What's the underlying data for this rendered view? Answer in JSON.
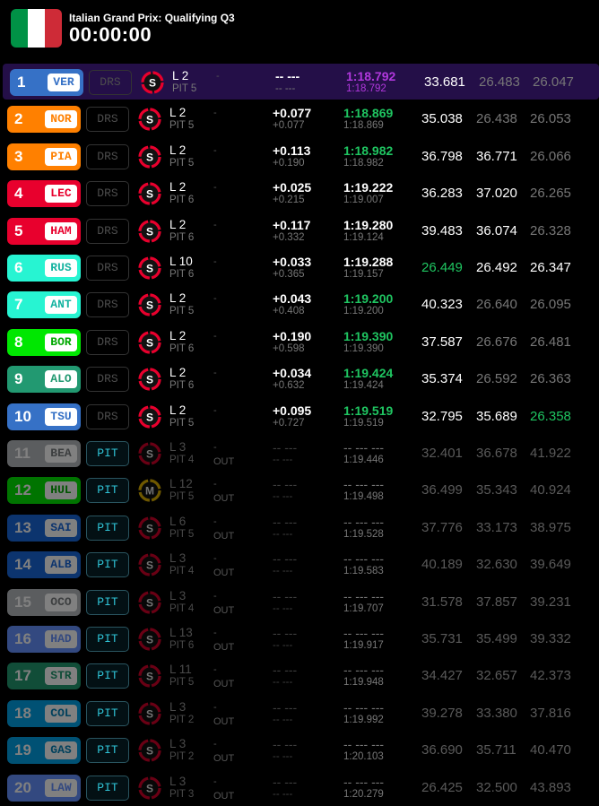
{
  "header": {
    "title": "Italian Grand Prix: Qualifying Q3",
    "timer": "00:00:00",
    "flag_colors": [
      "#009246",
      "#ffffff",
      "#ce2b37"
    ]
  },
  "colors": {
    "purple": "#b138dd",
    "green": "#1fc561",
    "white": "#ffffff",
    "grey": "#777777"
  },
  "drivers": [
    {
      "pos": "1",
      "code": "VER",
      "team_color": "#3671c6",
      "code_color": "#3671c6",
      "status": "DRS",
      "tyre": "S",
      "tyre_icon": "soft-tyre",
      "laps": "L 2",
      "pit": "PIT 5",
      "stint": "-",
      "stint2": "",
      "gap": "-- ---",
      "gap2": "-- ---",
      "best": "1:18.792",
      "best_color": "purple",
      "last": "1:18.792",
      "last_color": "purple",
      "s1": "33.681",
      "s1_color": "white",
      "s2": "26.483",
      "s2_color": "grey",
      "s3": "26.047",
      "s3_color": "grey",
      "out": false,
      "leader": true
    },
    {
      "pos": "2",
      "code": "NOR",
      "team_color": "#ff8000",
      "code_color": "#ff8000",
      "status": "DRS",
      "tyre": "S",
      "tyre_icon": "soft-tyre",
      "laps": "L 2",
      "pit": "PIT 5",
      "stint": "-",
      "stint2": "",
      "gap": "+0.077",
      "gap2": "+0.077",
      "best": "1:18.869",
      "best_color": "green",
      "last": "1:18.869",
      "last_color": "grey",
      "s1": "35.038",
      "s1_color": "white",
      "s2": "26.438",
      "s2_color": "grey",
      "s3": "26.053",
      "s3_color": "grey",
      "out": false,
      "leader": false
    },
    {
      "pos": "3",
      "code": "PIA",
      "team_color": "#ff8000",
      "code_color": "#ff8000",
      "status": "DRS",
      "tyre": "S",
      "tyre_icon": "soft-tyre",
      "laps": "L 2",
      "pit": "PIT 5",
      "stint": "-",
      "stint2": "",
      "gap": "+0.113",
      "gap2": "+0.190",
      "best": "1:18.982",
      "best_color": "green",
      "last": "1:18.982",
      "last_color": "grey",
      "s1": "36.798",
      "s1_color": "white",
      "s2": "36.771",
      "s2_color": "white",
      "s3": "26.066",
      "s3_color": "grey",
      "out": false,
      "leader": false
    },
    {
      "pos": "4",
      "code": "LEC",
      "team_color": "#e8002d",
      "code_color": "#e8002d",
      "status": "DRS",
      "tyre": "S",
      "tyre_icon": "soft-tyre",
      "laps": "L 2",
      "pit": "PIT 6",
      "stint": "-",
      "stint2": "",
      "gap": "+0.025",
      "gap2": "+0.215",
      "best": "1:19.222",
      "best_color": "white",
      "last": "1:19.007",
      "last_color": "grey",
      "s1": "36.283",
      "s1_color": "white",
      "s2": "37.020",
      "s2_color": "white",
      "s3": "26.265",
      "s3_color": "grey",
      "out": false,
      "leader": false
    },
    {
      "pos": "5",
      "code": "HAM",
      "team_color": "#e8002d",
      "code_color": "#e8002d",
      "status": "DRS",
      "tyre": "S",
      "tyre_icon": "soft-tyre",
      "laps": "L 2",
      "pit": "PIT 6",
      "stint": "-",
      "stint2": "",
      "gap": "+0.117",
      "gap2": "+0.332",
      "best": "1:19.280",
      "best_color": "white",
      "last": "1:19.124",
      "last_color": "grey",
      "s1": "39.483",
      "s1_color": "white",
      "s2": "36.074",
      "s2_color": "white",
      "s3": "26.328",
      "s3_color": "grey",
      "out": false,
      "leader": false
    },
    {
      "pos": "6",
      "code": "RUS",
      "team_color": "#27f4d2",
      "code_color": "#14b3a0",
      "status": "DRS",
      "tyre": "S",
      "tyre_icon": "soft-tyre",
      "laps": "L 10",
      "pit": "PIT 6",
      "stint": "-",
      "stint2": "",
      "gap": "+0.033",
      "gap2": "+0.365",
      "best": "1:19.288",
      "best_color": "white",
      "last": "1:19.157",
      "last_color": "grey",
      "s1": "26.449",
      "s1_color": "green",
      "s2": "26.492",
      "s2_color": "white",
      "s3": "26.347",
      "s3_color": "white",
      "out": false,
      "leader": false
    },
    {
      "pos": "7",
      "code": "ANT",
      "team_color": "#27f4d2",
      "code_color": "#14b3a0",
      "status": "DRS",
      "tyre": "S",
      "tyre_icon": "soft-tyre",
      "laps": "L 2",
      "pit": "PIT 5",
      "stint": "-",
      "stint2": "",
      "gap": "+0.043",
      "gap2": "+0.408",
      "best": "1:19.200",
      "best_color": "green",
      "last": "1:19.200",
      "last_color": "grey",
      "s1": "40.323",
      "s1_color": "white",
      "s2": "26.640",
      "s2_color": "grey",
      "s3": "26.095",
      "s3_color": "grey",
      "out": false,
      "leader": false
    },
    {
      "pos": "8",
      "code": "BOR",
      "team_color": "#00e701",
      "code_color": "#00a800",
      "status": "DRS",
      "tyre": "S",
      "tyre_icon": "soft-tyre",
      "laps": "L 2",
      "pit": "PIT 6",
      "stint": "-",
      "stint2": "",
      "gap": "+0.190",
      "gap2": "+0.598",
      "best": "1:19.390",
      "best_color": "green",
      "last": "1:19.390",
      "last_color": "grey",
      "s1": "37.587",
      "s1_color": "white",
      "s2": "26.676",
      "s2_color": "grey",
      "s3": "26.481",
      "s3_color": "grey",
      "out": false,
      "leader": false
    },
    {
      "pos": "9",
      "code": "ALO",
      "team_color": "#229971",
      "code_color": "#229971",
      "status": "DRS",
      "tyre": "S",
      "tyre_icon": "soft-tyre",
      "laps": "L 2",
      "pit": "PIT 6",
      "stint": "-",
      "stint2": "",
      "gap": "+0.034",
      "gap2": "+0.632",
      "best": "1:19.424",
      "best_color": "green",
      "last": "1:19.424",
      "last_color": "grey",
      "s1": "35.374",
      "s1_color": "white",
      "s2": "26.592",
      "s2_color": "grey",
      "s3": "26.363",
      "s3_color": "grey",
      "out": false,
      "leader": false
    },
    {
      "pos": "10",
      "code": "TSU",
      "team_color": "#3671c6",
      "code_color": "#3671c6",
      "status": "DRS",
      "tyre": "S",
      "tyre_icon": "soft-tyre",
      "laps": "L 2",
      "pit": "PIT 5",
      "stint": "-",
      "stint2": "",
      "gap": "+0.095",
      "gap2": "+0.727",
      "best": "1:19.519",
      "best_color": "green",
      "last": "1:19.519",
      "last_color": "grey",
      "s1": "32.795",
      "s1_color": "white",
      "s2": "35.689",
      "s2_color": "white",
      "s3": "26.358",
      "s3_color": "green",
      "out": false,
      "leader": false
    },
    {
      "pos": "11",
      "code": "BEA",
      "team_color": "#b6babd",
      "code_color": "#7a7e80",
      "status": "PIT",
      "tyre": "S",
      "tyre_icon": "soft-tyre",
      "laps": "L 3",
      "pit": "PIT 4",
      "stint": "-",
      "stint2": "OUT",
      "gap": "-- ---",
      "gap2": "-- ---",
      "best": "-- --- ---",
      "best_color": "grey",
      "last": "1:19.446",
      "last_color": "grey",
      "s1": "32.401",
      "s1_color": "grey",
      "s2": "36.678",
      "s2_color": "grey",
      "s3": "41.922",
      "s3_color": "grey",
      "out": true,
      "leader": false
    },
    {
      "pos": "12",
      "code": "HUL",
      "team_color": "#00e701",
      "code_color": "#00a800",
      "status": "PIT",
      "tyre": "M",
      "tyre_icon": "medium-tyre",
      "laps": "L 12",
      "pit": "PIT 5",
      "stint": "-",
      "stint2": "OUT",
      "gap": "-- ---",
      "gap2": "-- ---",
      "best": "-- --- ---",
      "best_color": "grey",
      "last": "1:19.498",
      "last_color": "grey",
      "s1": "36.499",
      "s1_color": "grey",
      "s2": "35.343",
      "s2_color": "grey",
      "s3": "40.924",
      "s3_color": "grey",
      "out": true,
      "leader": false
    },
    {
      "pos": "13",
      "code": "SAI",
      "team_color": "#1868db",
      "code_color": "#1868db",
      "status": "PIT",
      "tyre": "S",
      "tyre_icon": "soft-tyre",
      "laps": "L 6",
      "pit": "PIT 5",
      "stint": "-",
      "stint2": "OUT",
      "gap": "-- ---",
      "gap2": "-- ---",
      "best": "-- --- ---",
      "best_color": "grey",
      "last": "1:19.528",
      "last_color": "grey",
      "s1": "37.776",
      "s1_color": "grey",
      "s2": "33.173",
      "s2_color": "grey",
      "s3": "38.975",
      "s3_color": "grey",
      "out": true,
      "leader": false
    },
    {
      "pos": "14",
      "code": "ALB",
      "team_color": "#1868db",
      "code_color": "#1868db",
      "status": "PIT",
      "tyre": "S",
      "tyre_icon": "soft-tyre",
      "laps": "L 3",
      "pit": "PIT 4",
      "stint": "-",
      "stint2": "OUT",
      "gap": "-- ---",
      "gap2": "-- ---",
      "best": "-- --- ---",
      "best_color": "grey",
      "last": "1:19.583",
      "last_color": "grey",
      "s1": "40.189",
      "s1_color": "grey",
      "s2": "32.630",
      "s2_color": "grey",
      "s3": "39.649",
      "s3_color": "grey",
      "out": true,
      "leader": false
    },
    {
      "pos": "15",
      "code": "OCO",
      "team_color": "#b6babd",
      "code_color": "#7a7e80",
      "status": "PIT",
      "tyre": "S",
      "tyre_icon": "soft-tyre",
      "laps": "L 3",
      "pit": "PIT 4",
      "stint": "-",
      "stint2": "OUT",
      "gap": "-- ---",
      "gap2": "-- ---",
      "best": "-- --- ---",
      "best_color": "grey",
      "last": "1:19.707",
      "last_color": "grey",
      "s1": "31.578",
      "s1_color": "grey",
      "s2": "37.857",
      "s2_color": "grey",
      "s3": "39.231",
      "s3_color": "grey",
      "out": true,
      "leader": false
    },
    {
      "pos": "16",
      "code": "HAD",
      "team_color": "#6692ff",
      "code_color": "#6692ff",
      "status": "PIT",
      "tyre": "S",
      "tyre_icon": "soft-tyre",
      "laps": "L 13",
      "pit": "PIT 6",
      "stint": "-",
      "stint2": "OUT",
      "gap": "-- ---",
      "gap2": "-- ---",
      "best": "-- --- ---",
      "best_color": "grey",
      "last": "1:19.917",
      "last_color": "grey",
      "s1": "35.731",
      "s1_color": "grey",
      "s2": "35.499",
      "s2_color": "grey",
      "s3": "39.332",
      "s3_color": "grey",
      "out": true,
      "leader": false
    },
    {
      "pos": "17",
      "code": "STR",
      "team_color": "#229971",
      "code_color": "#229971",
      "status": "PIT",
      "tyre": "S",
      "tyre_icon": "soft-tyre",
      "laps": "L 11",
      "pit": "PIT 5",
      "stint": "-",
      "stint2": "OUT",
      "gap": "-- ---",
      "gap2": "-- ---",
      "best": "-- --- ---",
      "best_color": "grey",
      "last": "1:19.948",
      "last_color": "grey",
      "s1": "34.427",
      "s1_color": "grey",
      "s2": "32.657",
      "s2_color": "grey",
      "s3": "42.373",
      "s3_color": "grey",
      "out": true,
      "leader": false
    },
    {
      "pos": "18",
      "code": "COL",
      "team_color": "#00a1e8",
      "code_color": "#0080b8",
      "status": "PIT",
      "tyre": "S",
      "tyre_icon": "soft-tyre",
      "laps": "L 3",
      "pit": "PIT 2",
      "stint": "-",
      "stint2": "OUT",
      "gap": "-- ---",
      "gap2": "-- ---",
      "best": "-- --- ---",
      "best_color": "grey",
      "last": "1:19.992",
      "last_color": "grey",
      "s1": "39.278",
      "s1_color": "grey",
      "s2": "33.380",
      "s2_color": "grey",
      "s3": "37.816",
      "s3_color": "grey",
      "out": true,
      "leader": false
    },
    {
      "pos": "19",
      "code": "GAS",
      "team_color": "#00a1e8",
      "code_color": "#0080b8",
      "status": "PIT",
      "tyre": "S",
      "tyre_icon": "soft-tyre",
      "laps": "L 3",
      "pit": "PIT 2",
      "stint": "-",
      "stint2": "OUT",
      "gap": "-- ---",
      "gap2": "-- ---",
      "best": "-- --- ---",
      "best_color": "grey",
      "last": "1:20.103",
      "last_color": "grey",
      "s1": "36.690",
      "s1_color": "grey",
      "s2": "35.711",
      "s2_color": "grey",
      "s3": "40.470",
      "s3_color": "grey",
      "out": true,
      "leader": false
    },
    {
      "pos": "20",
      "code": "LAW",
      "team_color": "#6692ff",
      "code_color": "#6692ff",
      "status": "PIT",
      "tyre": "S",
      "tyre_icon": "soft-tyre",
      "laps": "L 3",
      "pit": "PIT 3",
      "stint": "-",
      "stint2": "OUT",
      "gap": "-- ---",
      "gap2": "-- ---",
      "best": "-- --- ---",
      "best_color": "grey",
      "last": "1:20.279",
      "last_color": "grey",
      "s1": "26.425",
      "s1_color": "grey",
      "s2": "32.500",
      "s2_color": "grey",
      "s3": "43.893",
      "s3_color": "grey",
      "out": true,
      "leader": false
    }
  ]
}
